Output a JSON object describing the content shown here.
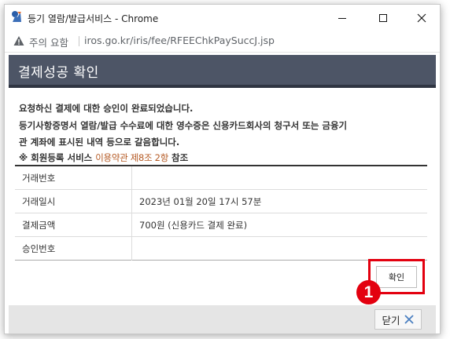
{
  "window": {
    "title": "등기 열람/발급서비스 - Chrome"
  },
  "address_bar": {
    "security_label": "주의 요함",
    "url": "iros.go.kr/iris/fee/RFEEChkPaySuccJ.jsp"
  },
  "page": {
    "header_title": "결제성공 확인",
    "message_line1": "요청하신 결제에 대한 승인이 완료되었습니다.",
    "message_line2": "등기사항증명서 열람/발급 수수료에 대한 영수증은 신용카드회사의 청구서 또는 금융기",
    "message_line3": "관 계좌에 표시된 내역 등으로 갈음합니다.",
    "notice_prefix": "※ 회원등록 서비스",
    "notice_link": "이용약관 제8조 2항",
    "notice_suffix": "참조",
    "table": [
      {
        "label": "거래번호",
        "value": ""
      },
      {
        "label": "거래일시",
        "value": "2023년 01월 20일 17시 57분"
      },
      {
        "label": "결제금액",
        "value": "700원 (신용카드 결제 완료)"
      },
      {
        "label": "승인번호",
        "value": ""
      }
    ],
    "confirm_label": "확인",
    "callout_number": "1",
    "close_label": "닫기"
  },
  "colors": {
    "header_bg": "#4d5566",
    "highlight": "#e3000f",
    "link": "#b55a24"
  },
  "icons": {
    "app": "court-logo-icon",
    "minimize": "minimize-icon",
    "maximize": "maximize-icon",
    "close": "close-icon",
    "warning": "warning-icon",
    "close_x": "close-x-icon"
  }
}
